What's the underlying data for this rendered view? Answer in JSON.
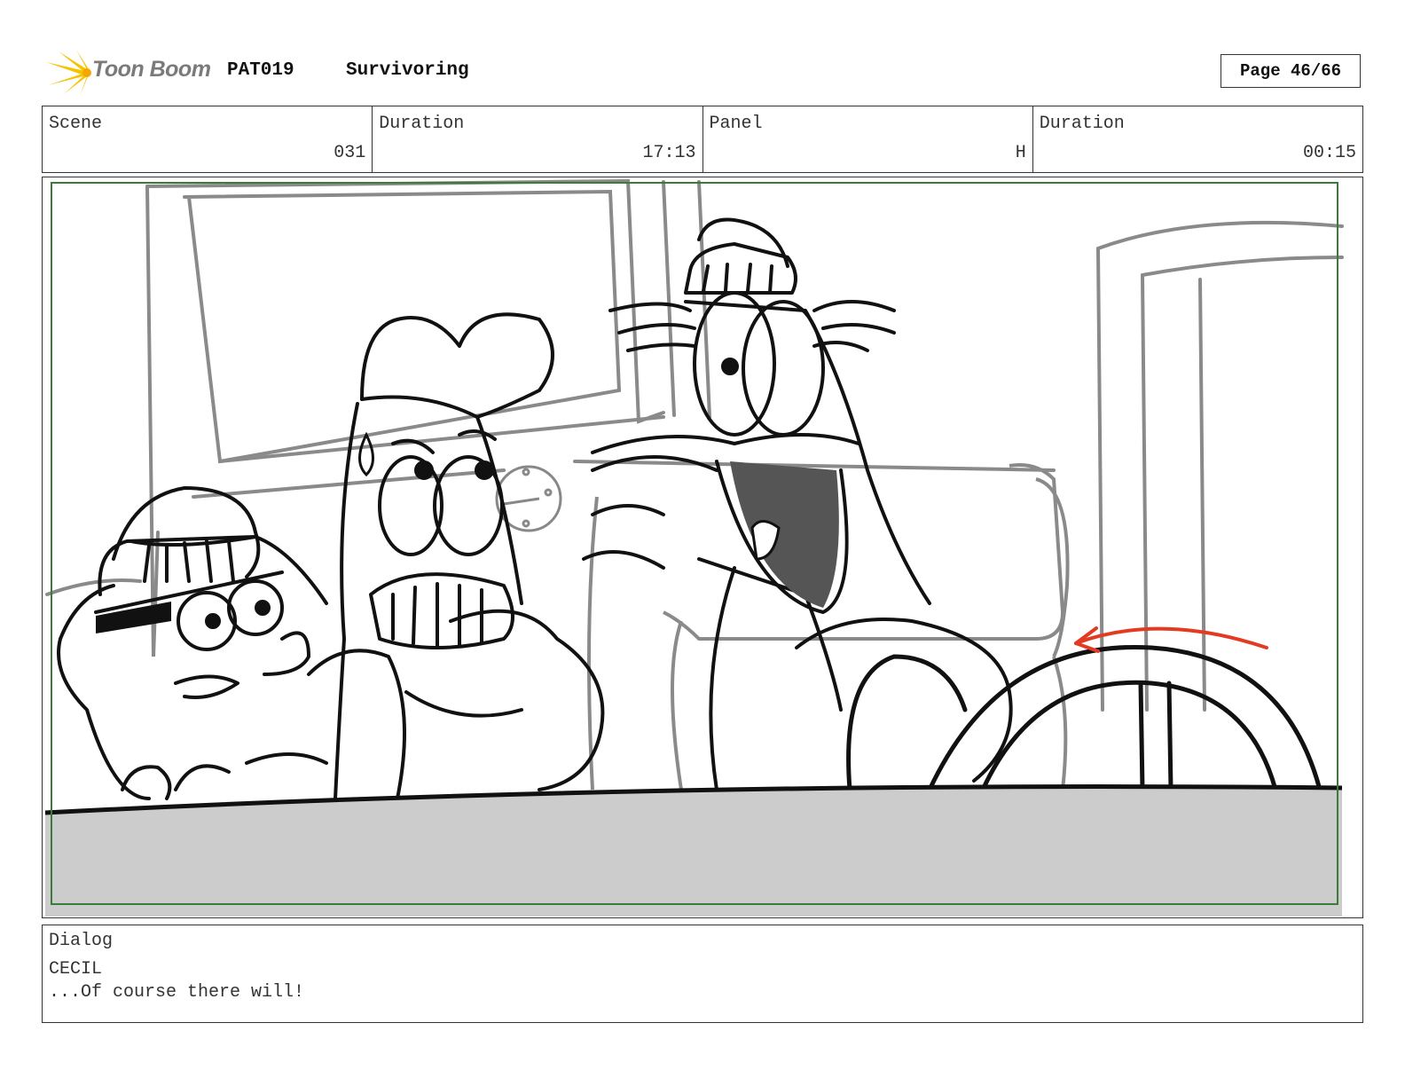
{
  "header": {
    "logo_text": "Toon Boom",
    "project_code": "PAT019",
    "project_title": "Survivoring",
    "page_label": "Page 46/66"
  },
  "info": {
    "scene_label": "Scene",
    "scene_value": "031",
    "scene_duration_label": "Duration",
    "scene_duration_value": "17:13",
    "panel_label": "Panel",
    "panel_value": "H",
    "panel_duration_label": "Duration",
    "panel_duration_value": "00:15"
  },
  "dialog": {
    "label": "Dialog",
    "speaker": "CECIL",
    "line": "...Of course there will!"
  },
  "colors": {
    "safe_area": "#3a7d3a",
    "arrow": "#e23b22",
    "logo_star": "#f5c400",
    "dashboard": "#cccccc"
  }
}
